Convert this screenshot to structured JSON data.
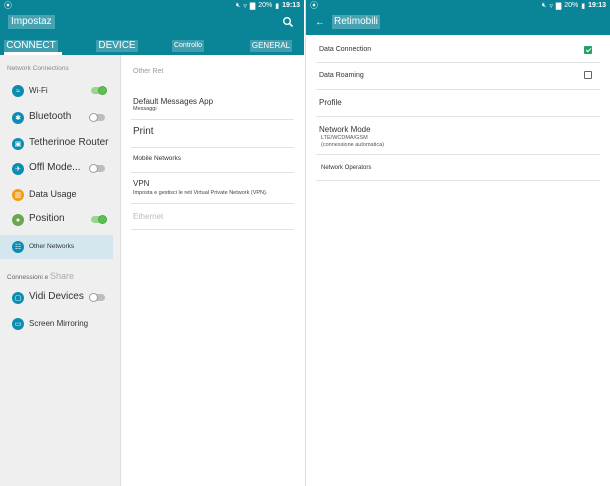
{
  "left": {
    "status": {
      "carrier_icon": "sync-icon",
      "battery": "20%",
      "time": "19:13"
    },
    "title": "Impostaz",
    "tabs": [
      {
        "label": "CONNECT",
        "active": true
      },
      {
        "label": "DEVICE",
        "active": false
      },
      {
        "label": "Controllo",
        "active": false
      },
      {
        "label": "GENERAL",
        "active": false
      }
    ],
    "sidebar": {
      "section1": "Network Connections",
      "items": [
        {
          "label": "Wi-Fi",
          "icon": "wifi-icon",
          "toggle": "on"
        },
        {
          "label": "Bluetooth",
          "icon": "bluetooth-icon",
          "toggle": "off"
        },
        {
          "label": "Tetherinoe Router",
          "icon": "tethering-icon"
        },
        {
          "label": "Offl Mode...",
          "icon": "airplane-icon",
          "toggle": "off"
        },
        {
          "label": "Data Usage",
          "icon": "data-usage-icon"
        },
        {
          "label": "Position",
          "icon": "location-icon",
          "toggle": "on"
        },
        {
          "label": "Other Networks",
          "icon": "networks-icon",
          "selected": true
        }
      ],
      "section2_pre": "Connessioni e ",
      "section2_post": "Share",
      "items2": [
        {
          "label": "Vidi Devices",
          "icon": "devices-icon",
          "toggle": "off"
        },
        {
          "label": "Screen Mirroring",
          "icon": "mirroring-icon"
        }
      ]
    },
    "content": {
      "header": "Other Ret",
      "rows": [
        {
          "title": "Default Messages App",
          "sub": "Messaggi"
        },
        {
          "title": "Print"
        },
        {
          "title": "Mobile Networks"
        },
        {
          "title": "VPN",
          "sub": "Imposta e gestisci le reti Virtual Private Network (VPN)."
        },
        {
          "title": "Ethernet",
          "disabled": true
        }
      ]
    }
  },
  "right": {
    "status": {
      "battery": "20%",
      "time": "19:13"
    },
    "title": "Retimobili",
    "rows": [
      {
        "title": "Data Connection",
        "checked": true
      },
      {
        "title": "Data Roaming",
        "checked": false
      },
      {
        "title": "Profile"
      },
      {
        "title": "Network Mode",
        "sub1": "LTE/WCDMA/GSM",
        "sub2": "(connessione automatica)"
      },
      {
        "title": "Network Operators"
      }
    ]
  },
  "colors": {
    "accent": "#0a8598",
    "toggle_on": "#5cc24f",
    "checkbox_on": "#1fa36a"
  }
}
